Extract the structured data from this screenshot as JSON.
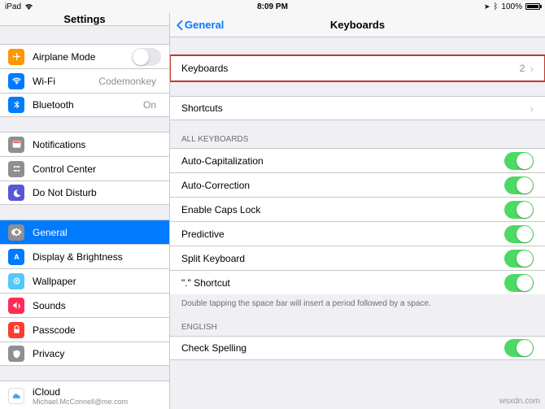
{
  "status": {
    "carrier": "iPad",
    "time": "8:09 PM",
    "battery_pct": "100%"
  },
  "sidebar": {
    "title": "Settings",
    "airplane": {
      "label": "Airplane Mode",
      "on": false
    },
    "wifi": {
      "label": "Wi-Fi",
      "value": "Codemonkey"
    },
    "bluetooth": {
      "label": "Bluetooth",
      "value": "On"
    },
    "notifications": {
      "label": "Notifications"
    },
    "control_center": {
      "label": "Control Center"
    },
    "dnd": {
      "label": "Do Not Disturb"
    },
    "general": {
      "label": "General"
    },
    "display": {
      "label": "Display & Brightness"
    },
    "wallpaper": {
      "label": "Wallpaper"
    },
    "sounds": {
      "label": "Sounds"
    },
    "passcode": {
      "label": "Passcode"
    },
    "privacy": {
      "label": "Privacy"
    },
    "icloud": {
      "label": "iCloud",
      "subtitle": "Michael.McConnell@me.com"
    }
  },
  "detail": {
    "back_label": "General",
    "title": "Keyboards",
    "keyboards_row": {
      "label": "Keyboards",
      "value": "2"
    },
    "shortcuts_row": {
      "label": "Shortcuts"
    },
    "group_all": "ALL KEYBOARDS",
    "auto_cap": {
      "label": "Auto-Capitalization",
      "on": true
    },
    "auto_corr": {
      "label": "Auto-Correction",
      "on": true
    },
    "caps_lock": {
      "label": "Enable Caps Lock",
      "on": true
    },
    "predictive": {
      "label": "Predictive",
      "on": true
    },
    "split_kb": {
      "label": "Split Keyboard",
      "on": true
    },
    "period": {
      "label": "\".\" Shortcut",
      "on": true
    },
    "footer_all": "Double tapping the space bar will insert a period followed by a space.",
    "group_english": "ENGLISH",
    "check_spelling": {
      "label": "Check Spelling",
      "on": true
    }
  },
  "watermark": "wsxdn.com"
}
